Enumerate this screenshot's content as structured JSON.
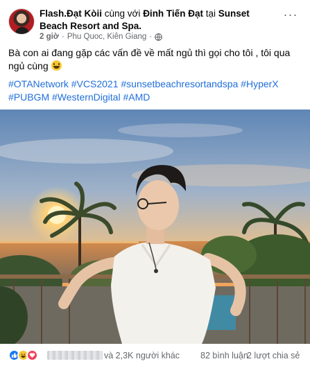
{
  "post": {
    "author": "Flash.Đạt Kòii",
    "with_word": "cùng với",
    "tagged_friend": "Đinh Tiến Đạt",
    "at_word": "tại",
    "location": "Sunset Beach Resort and Spa",
    "location_suffix": ".",
    "time": "2 giờ",
    "separator": "·",
    "place": "Phu Quoc, Kiên Giang",
    "separator2": "·",
    "privacy_icon": "globe-icon",
    "more_label": "···",
    "text": "Bà con ai đang gặp các vấn đề về mất ngủ thì gọi cho tôi , tôi qua ngủ cùng",
    "text_emoji": "grinning-face-emoji",
    "hashtags": [
      "#OTANetwork",
      "#VCS2021",
      "#sunsetbeachresortandspa",
      "#HyperX",
      "#PUBGM",
      "#WesternDigital",
      "#AMD"
    ]
  },
  "footer": {
    "reaction_icons": [
      "like-icon",
      "haha-icon",
      "love-icon"
    ],
    "likes_text": "và 2,3K người khác",
    "comments_text": "82 bình luận",
    "shares_text": "2 lượt chia sẻ"
  },
  "colors": {
    "link": "#216fdb",
    "meta": "#65676b",
    "like": "#1877f2",
    "love": "#f33e58",
    "haha": "#f7c636"
  }
}
